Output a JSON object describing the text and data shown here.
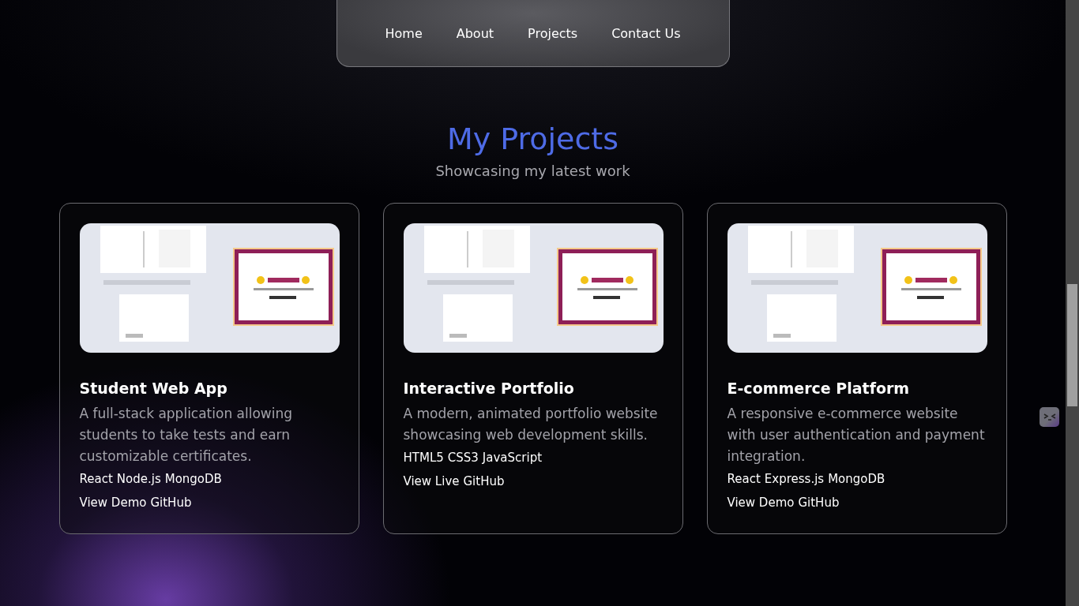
{
  "nav": {
    "items": [
      {
        "label": "Home"
      },
      {
        "label": "About"
      },
      {
        "label": "Projects"
      },
      {
        "label": "Contact Us"
      }
    ]
  },
  "section": {
    "title": "My Projects",
    "subtitle": "Showcasing my latest work"
  },
  "projects": [
    {
      "image": {
        "kind": "picture"
      },
      "title": "Student Web App",
      "description": "A full-stack application allowing students to take tests and earn customizable certificates.",
      "tags": [
        "React",
        "Node.js",
        "MongoDB"
      ],
      "links": [
        "View Demo",
        "GitHub"
      ]
    },
    {
      "image": {
        "kind": "picture"
      },
      "title": "Interactive Portfolio",
      "description": "A modern, animated portfolio website showcasing web development skills.",
      "tags": [
        "HTML5",
        "CSS3",
        "JavaScript"
      ],
      "links": [
        "View Live",
        "GitHub"
      ]
    },
    {
      "image": {
        "kind": "picture"
      },
      "title": "E-commerce Platform",
      "description": "A responsive e-commerce website with user authentication and payment integration.",
      "tags": [
        "React",
        "Express.js",
        "MongoDB"
      ],
      "links": [
        "View Demo",
        "GitHub"
      ]
    }
  ]
}
